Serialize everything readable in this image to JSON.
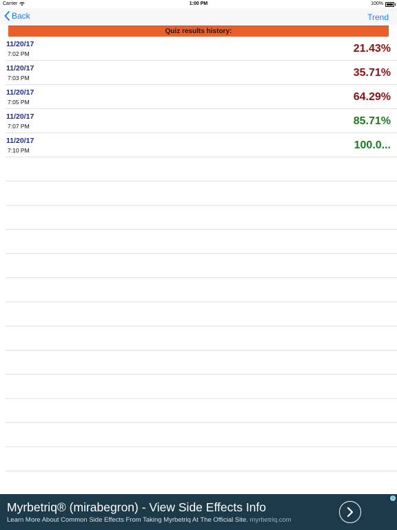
{
  "status": {
    "carrier": "Carrier",
    "time": "1:00 PM",
    "battery": "100%"
  },
  "nav": {
    "back_label": "Back",
    "trend_label": "Trend"
  },
  "header": {
    "title": "Quiz results history:"
  },
  "results": [
    {
      "date": "11/20/17",
      "time": "7:02 PM",
      "score": "21.43%",
      "color": "#8b1010"
    },
    {
      "date": "11/20/17",
      "time": "7:03 PM",
      "score": "35.71%",
      "color": "#8b1010"
    },
    {
      "date": "11/20/17",
      "time": "7:05 PM",
      "score": "64.29%",
      "color": "#8b1010"
    },
    {
      "date": "11/20/17",
      "time": "7:07 PM",
      "score": "85.71%",
      "color": "#1e7a1e"
    },
    {
      "date": "11/20/17",
      "time": "7:10 PM",
      "score": "100.0...",
      "color": "#1e7a1e"
    }
  ],
  "ad": {
    "title": "Myrbetriq® (mirabegron) - View Side Effects Info",
    "subtitle": "Learn More About Common Side Effects From Taking Myrbetriq At The Official Site.",
    "domain": "myrbetriq.com"
  },
  "colors": {
    "accent": "#1a7cf5",
    "banner": "#e8602c",
    "ad_background": "#1c3a4a"
  }
}
